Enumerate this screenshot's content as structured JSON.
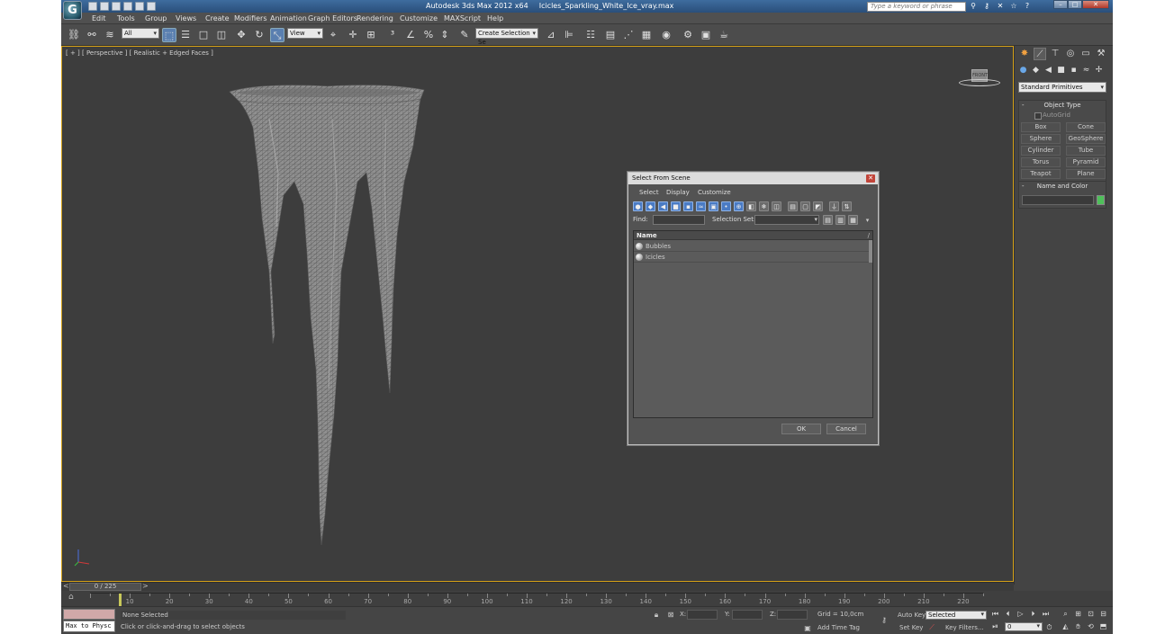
{
  "titlebar": {
    "app_title": "Autodesk 3ds Max  2012 x64",
    "file_name": "Icicles_Sparkling_White_Ice_vray.max",
    "search_placeholder": "Type a keyword or phrase",
    "logo_glyph": "G",
    "minimize": "–",
    "maximize": "□",
    "close": "✕"
  },
  "menu": {
    "items": [
      "Edit",
      "Tools",
      "Group",
      "Views",
      "Create",
      "Modifiers",
      "Animation",
      "Graph Editors",
      "Rendering",
      "Customize",
      "MAXScript",
      "Help"
    ]
  },
  "toolbar": {
    "selection_filter": "All",
    "reference_coord": "View",
    "named_selection": "Create Selection Se"
  },
  "viewport": {
    "label": "[ + ] [ Perspective ] [ Realistic + Edged Faces ]",
    "viewcube_label": "FRONT",
    "axis": {
      "x": "x",
      "y": "y",
      "z": "z"
    }
  },
  "command_panel": {
    "category": "Standard Primitives",
    "object_type_title": "Object Type",
    "autogrid_label": "AutoGrid",
    "primitives": [
      "Box",
      "Cone",
      "Sphere",
      "GeoSphere",
      "Cylinder",
      "Tube",
      "Torus",
      "Pyramid",
      "Teapot",
      "Plane"
    ],
    "name_color_title": "Name and Color",
    "object_color": "#4ec05a",
    "collapse_glyph": "-"
  },
  "time_slider": {
    "frame": "0 / 225",
    "prev": "<",
    "next": ">"
  },
  "trackbar": {
    "ticks": [
      "10",
      "20",
      "30",
      "40",
      "50",
      "60",
      "70",
      "80",
      "90",
      "100",
      "110",
      "120",
      "130",
      "140",
      "150",
      "160",
      "170",
      "180",
      "190",
      "200",
      "210",
      "220"
    ]
  },
  "status": {
    "maxscript_text": "Max to Physc",
    "selection_status": "None Selected",
    "prompt": "Click or click-and-drag to select objects",
    "x_label": "X:",
    "y_label": "Y:",
    "z_label": "Z:",
    "grid": "Grid = 10,0cm",
    "add_time_tag": "Add Time Tag",
    "auto_key": "Auto Key",
    "key_mode": "Selected",
    "set_key": "Set Key",
    "key_filters": "Key Filters...",
    "frame_field": "0"
  },
  "dialog": {
    "title": "Select From Scene",
    "close": "✕",
    "menu": [
      "Select",
      "Display",
      "Customize"
    ],
    "find_label": "Find:",
    "selection_set_label": "Selection Set:",
    "column_name": "Name",
    "sort_indicator": "/",
    "objects": [
      "Bubbles",
      "Icicles"
    ],
    "ok": "OK",
    "cancel": "Cancel"
  }
}
